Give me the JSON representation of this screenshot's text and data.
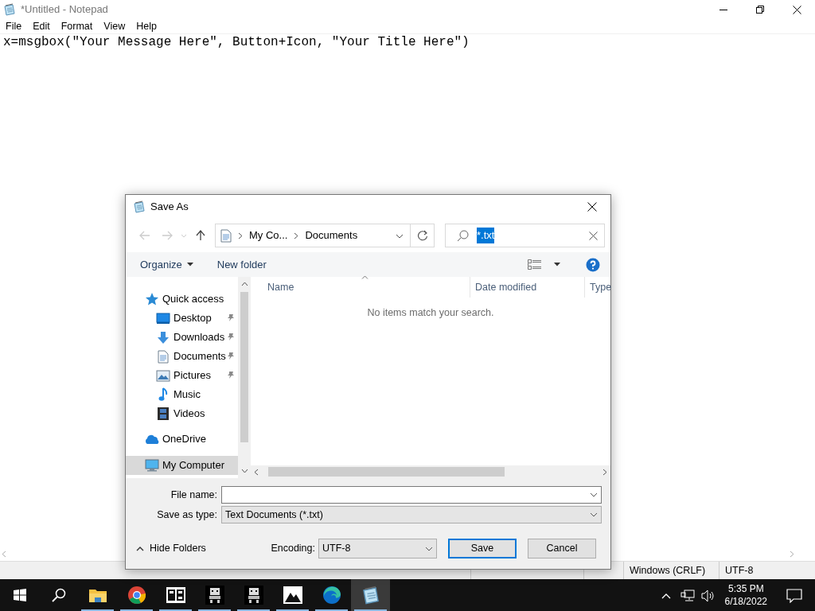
{
  "notepad": {
    "title": "*Untitled - Notepad",
    "menu": [
      "File",
      "Edit",
      "Format",
      "View",
      "Help"
    ],
    "text": "x=msgbox(\"Your Message Here\", Button+Icon, \"Your Title Here\")",
    "status_bar": [
      "Windows (CRLF)",
      "UTF-8"
    ]
  },
  "dialog": {
    "title": "Save As",
    "breadcrumb": [
      "My Co...",
      "Documents"
    ],
    "search": {
      "value": "*.txt",
      "highlighted": true
    },
    "toolbar": [
      "Organize",
      "New folder"
    ],
    "nav": [
      {
        "label": "Quick access",
        "pinned": false,
        "selected": false,
        "children": [
          {
            "label": "Desktop",
            "pinned": true,
            "selected": false
          },
          {
            "label": "Downloads",
            "pinned": true,
            "selected": false
          },
          {
            "label": "Documents",
            "pinned": true,
            "selected": false
          },
          {
            "label": "Pictures",
            "pinned": true,
            "selected": false
          },
          {
            "label": "Music",
            "pinned": false,
            "selected": false
          },
          {
            "label": "Videos",
            "pinned": false,
            "selected": false
          }
        ]
      },
      {
        "label": "OneDrive",
        "pinned": false,
        "selected": false
      },
      {
        "label": "My Computer",
        "pinned": false,
        "selected": true
      }
    ],
    "columns": [
      "Name",
      "Date modified",
      "Type"
    ],
    "empty_message": "No items match your search.",
    "file_name": {
      "label": "File name:"
    },
    "save_type": {
      "label": "Save as type:",
      "value": "Text Documents (*.txt)"
    },
    "hide_folders": "Hide Folders",
    "encoding": {
      "label": "Encoding:",
      "value": "UTF-8"
    },
    "buttons": [
      {
        "label": "Save",
        "default": true
      },
      {
        "label": "Cancel",
        "default": false
      }
    ]
  },
  "taskbar": {
    "apps": [
      {
        "kind": "start",
        "running": false,
        "active": false
      },
      {
        "kind": "search",
        "running": false,
        "active": false
      },
      {
        "kind": "explorer",
        "running": true,
        "active": false
      },
      {
        "kind": "chrome",
        "running": true,
        "active": false
      },
      {
        "kind": "sevenzip",
        "running": true,
        "active": false
      },
      {
        "kind": "pixelart",
        "running": true,
        "active": false
      },
      {
        "kind": "pixelart",
        "running": true,
        "active": false
      },
      {
        "kind": "photos",
        "running": true,
        "active": false
      },
      {
        "kind": "edge",
        "running": true,
        "active": false
      },
      {
        "kind": "notepad",
        "running": true,
        "active": true
      }
    ],
    "time": "5:35 PM",
    "date": "6/18/2022"
  }
}
